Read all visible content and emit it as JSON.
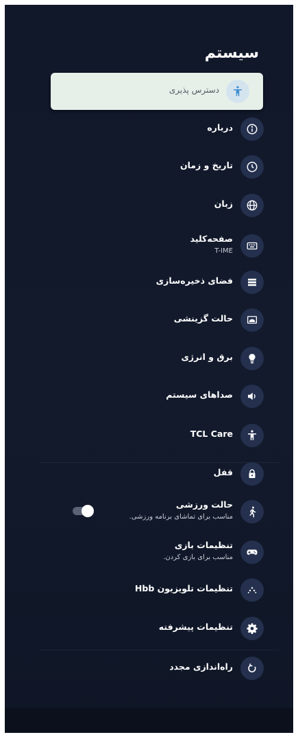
{
  "page": {
    "title": "سیستم"
  },
  "items": [
    {
      "label": "دسترس پذیری",
      "icon": "accessibility-icon",
      "selected": true
    },
    {
      "label": "درباره",
      "icon": "info-icon"
    },
    {
      "label": "تاریخ و زمان",
      "icon": "clock-icon"
    },
    {
      "label": "زبان",
      "icon": "globe-icon"
    },
    {
      "label": "صفحه‌کلید",
      "sub": "T-IME",
      "icon": "keyboard-icon"
    },
    {
      "label": "فضای ذخیره‌سازی",
      "icon": "storage-icon"
    },
    {
      "label": "حالت گزینشی",
      "icon": "ambient-mode-icon"
    },
    {
      "label": "برق و انرژی",
      "icon": "lightbulb-icon"
    },
    {
      "label": "صداهای سیستم",
      "icon": "volume-icon"
    },
    {
      "label": "TCL Care",
      "icon": "tcl-care-icon"
    },
    {
      "label": "قفل",
      "icon": "lock-icon"
    },
    {
      "label": "حالت ورزشی",
      "sub": "مناسب برای تماشای برنامه ورزشی.",
      "icon": "running-icon",
      "toggle": true,
      "toggle_on": true
    },
    {
      "label": "تنظیمات بازی",
      "sub": "مناسب برای بازی کردن.",
      "icon": "gamepad-icon"
    },
    {
      "label": "تنظیمات تلویزیون Hbb",
      "icon": "dots-icon"
    },
    {
      "label": "تنظیمات پیشرفته",
      "icon": "gear-icon"
    },
    {
      "label": "راه‌اندازی مجدد",
      "icon": "restart-icon"
    }
  ]
}
